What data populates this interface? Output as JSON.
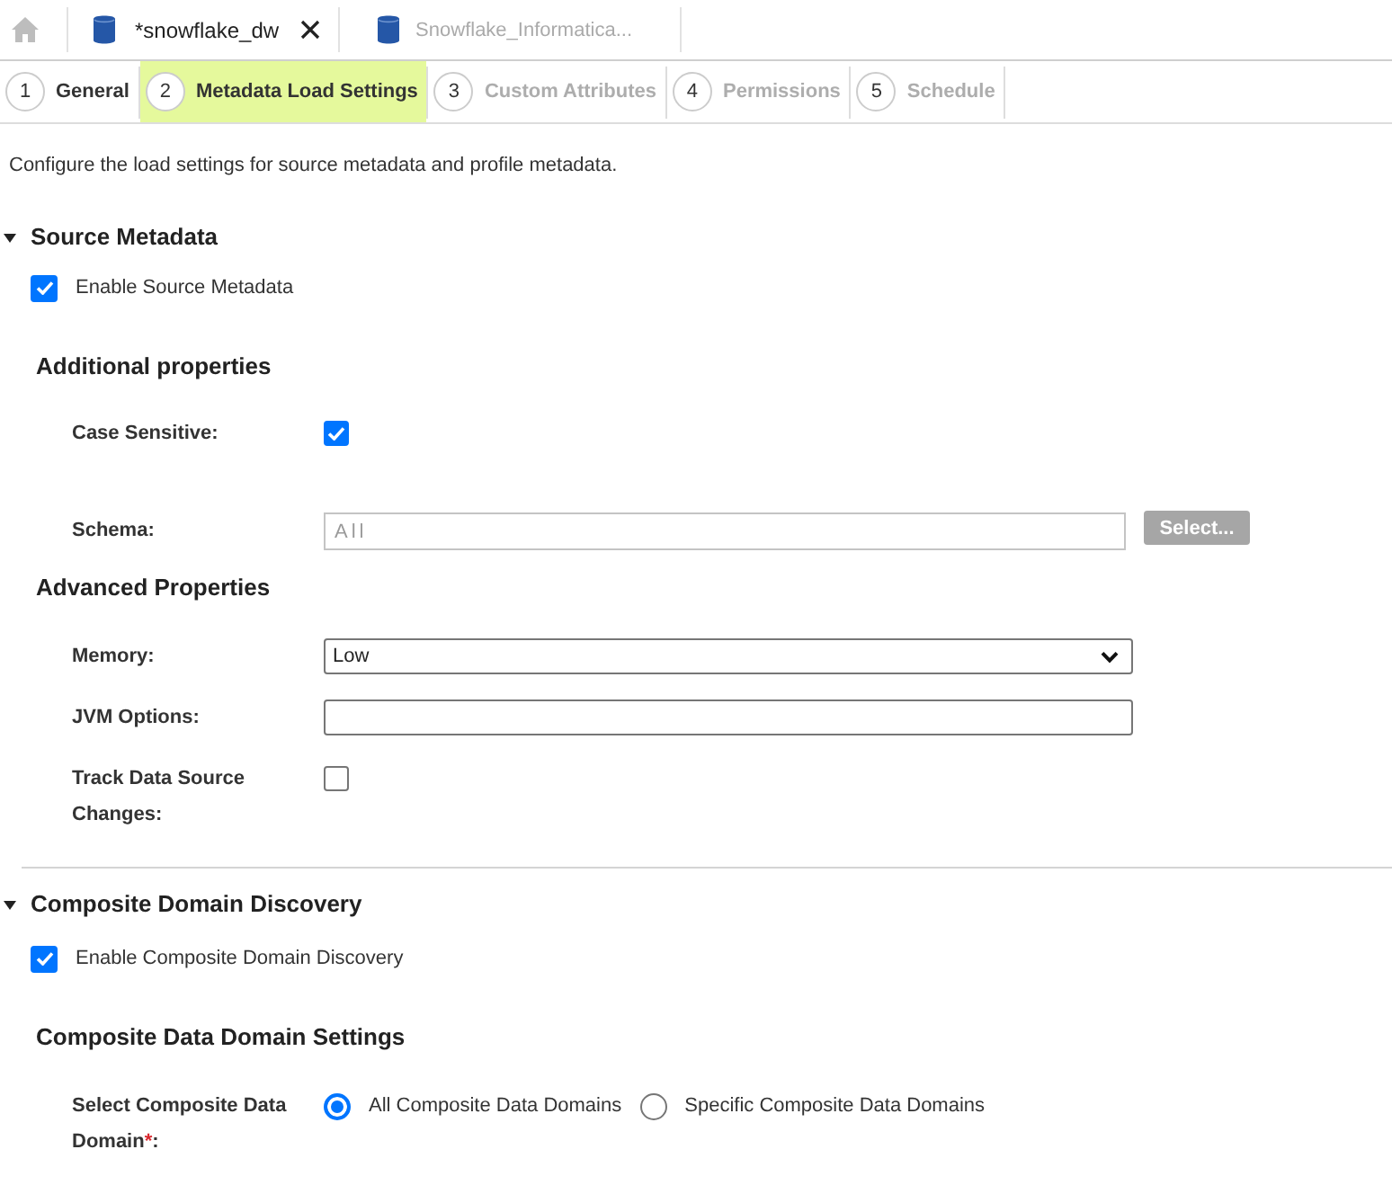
{
  "doc_tabs": [
    {
      "label": "*snowflake_dw",
      "selected": true
    },
    {
      "label": "Snowflake_Informatica...",
      "selected": false
    }
  ],
  "steps": [
    {
      "number": "1",
      "label": "General",
      "selected": false,
      "disabled": false
    },
    {
      "number": "2",
      "label": "Metadata Load Settings",
      "selected": true,
      "disabled": false
    },
    {
      "number": "3",
      "label": "Custom Attributes",
      "selected": false,
      "disabled": true
    },
    {
      "number": "4",
      "label": "Permissions",
      "selected": false,
      "disabled": true
    },
    {
      "number": "5",
      "label": "Schedule",
      "selected": false,
      "disabled": true
    }
  ],
  "description": "Configure the load settings for source metadata and profile metadata.",
  "sections": [
    {
      "title": "Source Metadata",
      "expanded": true,
      "enable": {
        "label": "Enable Source Metadata",
        "checked": true
      },
      "groups": [
        {
          "title": "Additional properties",
          "fields": [
            {
              "kind": "checkbox",
              "label": "Case Sensitive:",
              "checked": true
            },
            {
              "kind": "picker",
              "label": "Schema:",
              "value": "All",
              "disabled": true,
              "button": {
                "label": "Select...",
                "disabled": true
              }
            }
          ]
        },
        {
          "title": "Advanced Properties",
          "fields": [
            {
              "kind": "select",
              "label": "Memory:",
              "value": "Low"
            },
            {
              "kind": "text",
              "label": "JVM Options:"
            },
            {
              "kind": "checkbox",
              "label": "Track Data Source Changes:",
              "checked": false
            }
          ]
        }
      ]
    },
    {
      "title": "Composite Domain Discovery",
      "expanded": true,
      "enable": {
        "label": "Enable Composite Domain Discovery",
        "checked": true
      },
      "groups": [
        {
          "title": "Composite Data Domain Settings",
          "fields": [
            {
              "kind": "radio",
              "label": "Select Composite Data Domain",
              "required_mark": "*",
              "label_suffix": ":",
              "options": [
                {
                  "label": "All Composite Data Domains",
                  "selected": true
                },
                {
                  "label": "Specific Composite Data Domains",
                  "selected": false
                }
              ]
            }
          ]
        }
      ]
    }
  ]
}
